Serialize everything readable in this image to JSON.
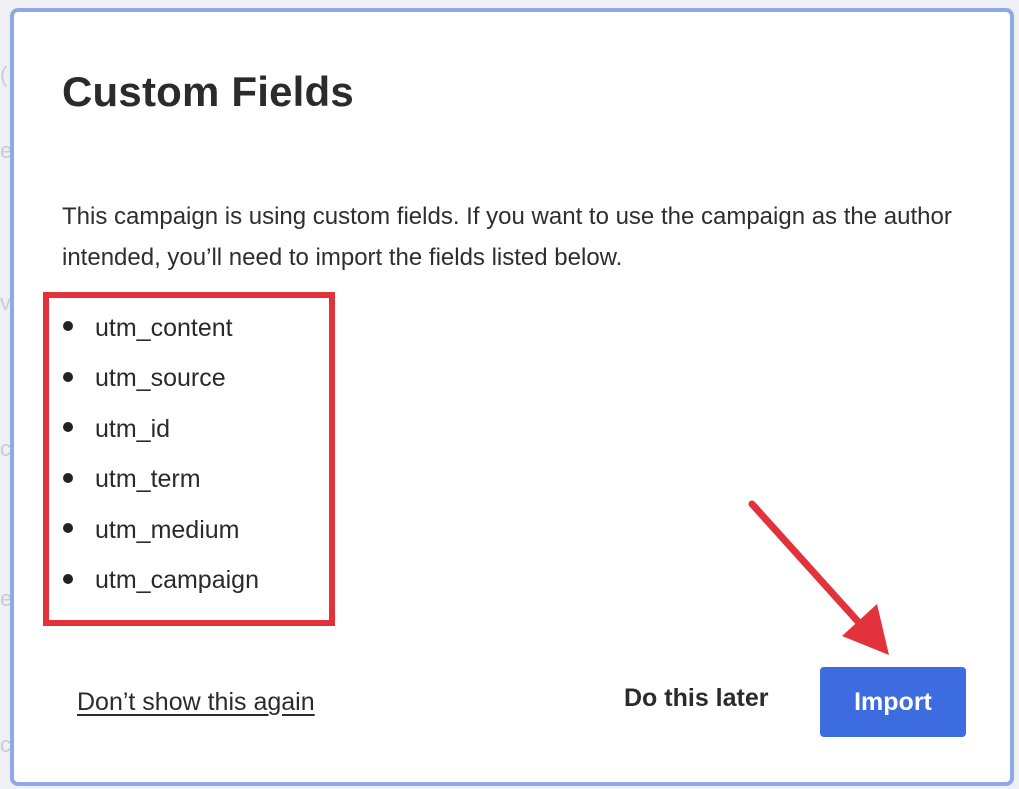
{
  "dialog": {
    "title": "Custom Fields",
    "description": "This campaign is using custom fields. If you want to use the campaign as the author intended, you’ll need to import the fields listed below.",
    "fields": [
      "utm_content",
      "utm_source",
      "utm_id",
      "utm_term",
      "utm_medium",
      "utm_campaign"
    ],
    "actions": {
      "dont_show_label": "Don’t show this again",
      "later_label": "Do this later",
      "import_label": "Import"
    }
  },
  "annotations": {
    "highlight_color": "#e2323b",
    "arrow_color": "#e2323b",
    "highlight_target": "fields-list",
    "arrow_target": "import-button"
  },
  "colors": {
    "accent": "#3d6ce0",
    "modal_border": "#8fa9e8",
    "text": "#2b2b2b"
  }
}
